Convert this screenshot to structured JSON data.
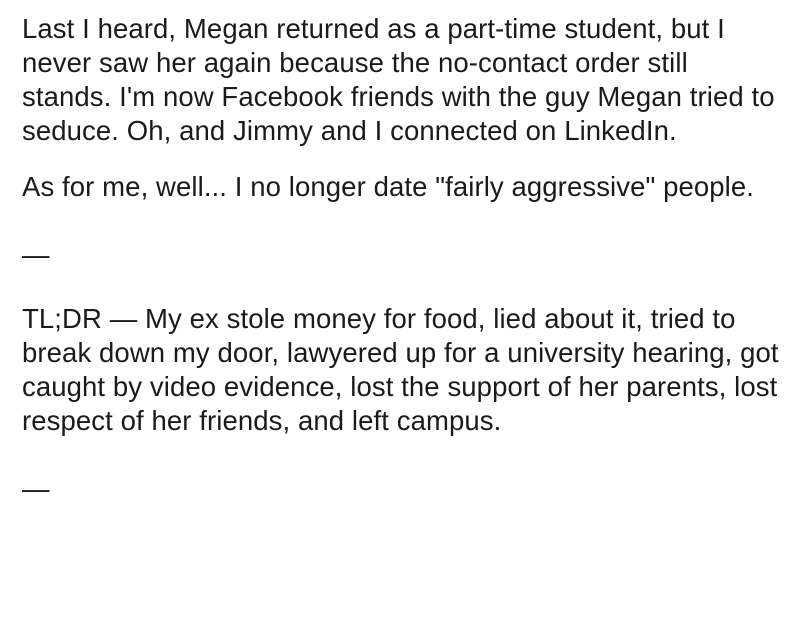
{
  "post": {
    "paragraphs": [
      "Last I heard, Megan returned as a part-time student, but I never saw her again because the no-contact order still stands. I'm now Facebook friends with the guy Megan tried to seduce. Oh, and Jimmy and I connected on LinkedIn.",
      "As for me, well... I no longer date \"fairly aggressive\" people.",
      "TL;DR — My ex stole money for food, lied about it, tried to break down my door, lawyered up for a university hearing, got caught by video evidence, lost the support of her parents, lost respect of her friends, and left campus."
    ],
    "separators": [
      "—",
      "—"
    ]
  }
}
